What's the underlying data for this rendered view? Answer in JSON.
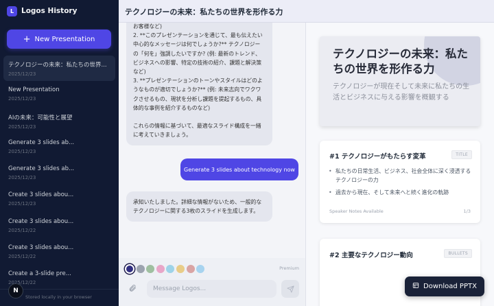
{
  "app": {
    "name": "Logos History",
    "logo_letter": "L"
  },
  "sidebar": {
    "new_button": "New Presentation",
    "items": [
      {
        "title": "テクノロジーの未来：私たちの世界...",
        "date": "2025/12/23"
      },
      {
        "title": "New Presentation",
        "date": "2025/12/23"
      },
      {
        "title": "AIの未来：可能性と展望",
        "date": "2025/12/23"
      },
      {
        "title": "Generate 3 slides ab...",
        "date": "2025/12/23"
      },
      {
        "title": "Generate 3 slides ab...",
        "date": "2025/12/23"
      },
      {
        "title": "Create 3 slides abou...",
        "date": "2025/12/23"
      },
      {
        "title": "Create 3 slides abou...",
        "date": "2025/12/22"
      },
      {
        "title": "Create 3 slides abou...",
        "date": "2025/12/22"
      },
      {
        "title": "Create a 3-slide pre...",
        "date": "2025/12/22"
      }
    ],
    "footer": "Stored locally in your browser",
    "avatar_letter": "N"
  },
  "header": {
    "title": "テクノロジーの未来：私たちの世界を形作る力"
  },
  "chat": {
    "ai_message_1": [
      "お客様など)\n2. **このプレゼンテーションを通じて、最も伝えたい中心的なメッセージは何でしょうか?** テクノロジーの「何を」強調したいですか? (例: 最新のトレンド、ビジネスへの影響、特定の技術の紹介、課題と解決策など)\n3. **プレゼンテーションのトーンやスタイルはどのようなものが適切でしょうか?** (例: 未来志向でワクワクさせるもの、現状を分析し課題を提起するもの、具体的な事例を紹介するものなど)",
      "これらの情報に基づいて、最適なスライド構成を一緒に考えていきましょう。"
    ],
    "user_message": "Generate 3 slides about technology now",
    "ai_message_2": "承知いたしました。詳細な情報がないため、一般的なテクノロジーに関する3枚のスライドを生成します。",
    "premium_label": "Premium",
    "input_placeholder": "Message Logos...",
    "swatches": [
      "#312e81",
      "#9ca3af",
      "#9fbfa0",
      "#e8a6c8",
      "#9ed3e8",
      "#e8cc88",
      "#d9a4a4",
      "#a7d3ef"
    ]
  },
  "preview": {
    "hero_title": "テクノロジーの未来：私たちの世界を形作る力",
    "hero_subtitle": "テクノロジーが現在そして未来に私たちの生活とビジネスに与える影響を概観する",
    "cards": [
      {
        "heading": "#1 テクノロジーがもたらす変革",
        "tag": "TITLE",
        "bullets": [
          "私たちの日常生活、ビジネス、社会全体に深く浸透するテクノロジーの力",
          "過去から現在、そして未来へと続く進化の軌跡"
        ],
        "notes": "Speaker Notes Available",
        "page": "1/3"
      },
      {
        "heading": "#2 主要なテクノロジー動向",
        "tag": "BULLETS"
      }
    ],
    "download_button": "Download PPTX"
  }
}
